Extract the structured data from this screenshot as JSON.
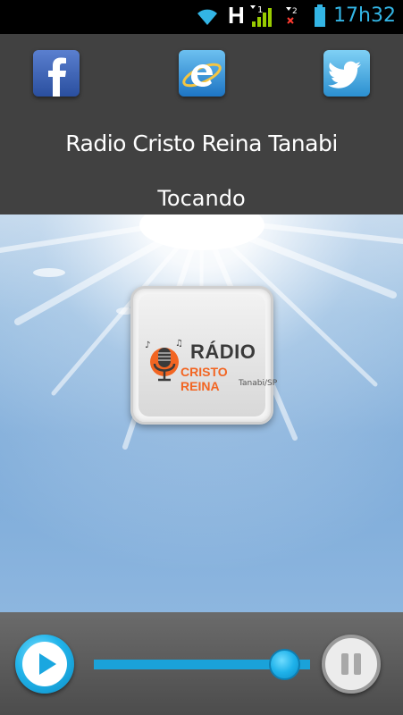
{
  "status_bar": {
    "network_letter": "H",
    "signal_sub": "1",
    "sim_sub": "2",
    "time": "17h32"
  },
  "header": {
    "station_name": "Radio Cristo Reina Tanabi",
    "status": "Tocando",
    "social": [
      {
        "icon": "facebook-icon"
      },
      {
        "icon": "internet-explorer-icon"
      },
      {
        "icon": "twitter-icon"
      }
    ]
  },
  "logo": {
    "line1": "RÁDIO",
    "line2": "CRISTO REINA",
    "line3": "Tanabi/SP"
  },
  "player": {
    "volume": 0.85,
    "accent_color": "#1aa2d9"
  }
}
